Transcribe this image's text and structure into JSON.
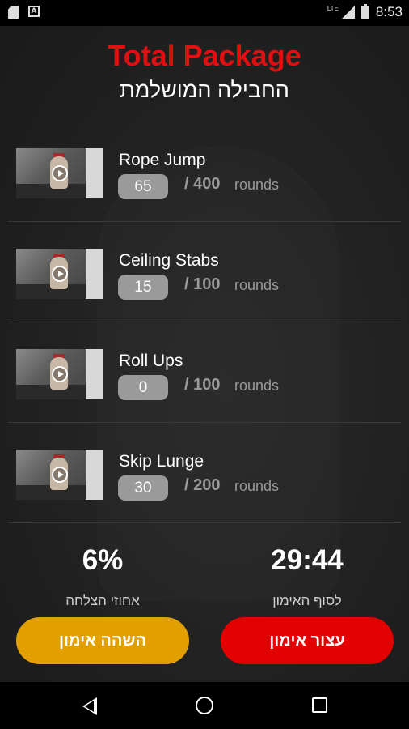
{
  "status_bar": {
    "time": "8:53",
    "network": "LTE",
    "icons": [
      "sd-card-icon",
      "autofill-a-icon",
      "signal-icon",
      "battery-icon"
    ]
  },
  "header": {
    "title": "Total Package",
    "subtitle": "החבילה המושלמת"
  },
  "exercises": [
    {
      "name": "Rope Jump",
      "done": "65",
      "total": "/ 400",
      "unit": "rounds"
    },
    {
      "name": "Ceiling Stabs",
      "done": "15",
      "total": "/ 100",
      "unit": "rounds"
    },
    {
      "name": "Roll Ups",
      "done": "0",
      "total": "/ 100",
      "unit": "rounds"
    },
    {
      "name": "Skip Lunge",
      "done": "30",
      "total": "/ 200",
      "unit": "rounds"
    }
  ],
  "stats": {
    "success_value": "6%",
    "success_label": "אחוזי הצלחה",
    "timer_value": "29:44",
    "timer_label": "לסוף האימון"
  },
  "buttons": {
    "pause_label": "השהה אימון",
    "stop_label": "עצור אימון"
  },
  "colors": {
    "title": "#e01010",
    "pause_button": "#e2a000",
    "stop_button": "#e20000",
    "count_pill": "#9a9a9a"
  }
}
